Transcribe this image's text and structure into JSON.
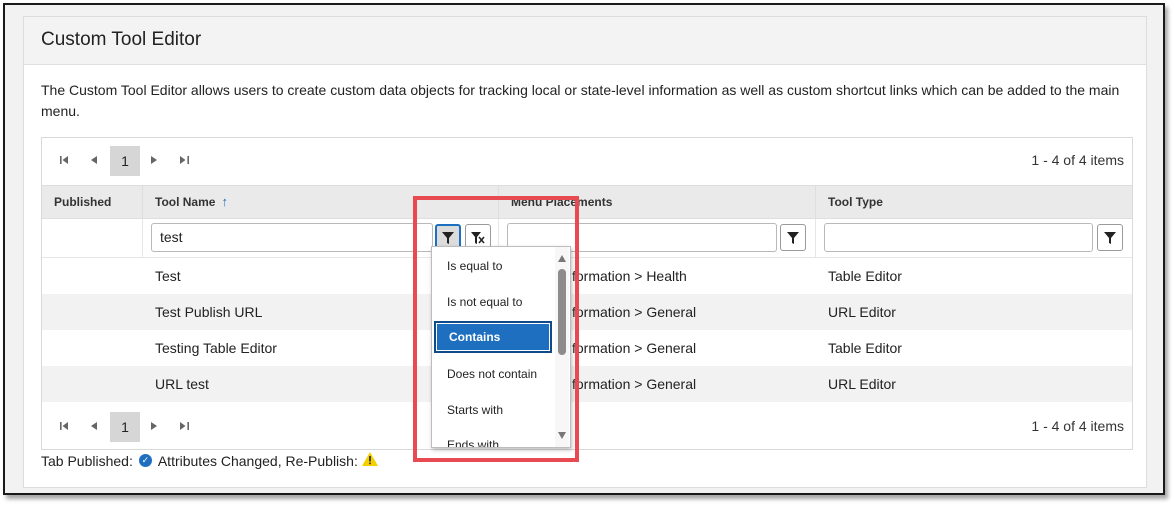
{
  "panel": {
    "title": "Custom Tool Editor",
    "description": "The Custom Tool Editor allows users to create custom data objects for tracking local or state-level information as well as custom shortcut links which can be added to the main menu."
  },
  "pager": {
    "current_page": "1",
    "info": "1 - 4 of 4 items"
  },
  "columns": {
    "published": "Published",
    "tool_name": "Tool Name",
    "menu_placements": "Menu Placements",
    "tool_type": "Tool Type"
  },
  "filters": {
    "tool_name_value": "test",
    "menu_placements_value": "",
    "tool_type_value": ""
  },
  "rows": [
    {
      "published": "",
      "tool_name": "Test",
      "menu_placements": "formation > Health",
      "tool_type": "Table Editor"
    },
    {
      "published": "",
      "tool_name": "Test Publish URL",
      "menu_placements": "formation > General",
      "tool_type": "URL Editor"
    },
    {
      "published": "",
      "tool_name": "Testing Table Editor",
      "menu_placements": "formation > General",
      "tool_type": "Table Editor"
    },
    {
      "published": "",
      "tool_name": "URL test",
      "menu_placements": "formation > General",
      "tool_type": "URL Editor"
    }
  ],
  "filter_operators": {
    "items": [
      "Is equal to",
      "Is not equal to",
      "Contains",
      "Does not contain",
      "Starts with",
      "Ends with"
    ],
    "selected": "Contains"
  },
  "legend": {
    "tab_published": "Tab Published:",
    "attributes_changed": "Attributes Changed, Re-Publish:"
  },
  "colors": {
    "accent": "#1f6fc1",
    "highlight": "#e84a52",
    "warning": "#f5d000"
  },
  "icons": {
    "first_page": "first-page-icon",
    "prev_page": "prev-page-icon",
    "next_page": "next-page-icon",
    "last_page": "last-page-icon",
    "filter": "filter-icon",
    "clear_filter": "clear-filter-icon",
    "sort": "sort-ascending-icon",
    "published": "check-circle-icon",
    "warning": "warning-icon"
  }
}
